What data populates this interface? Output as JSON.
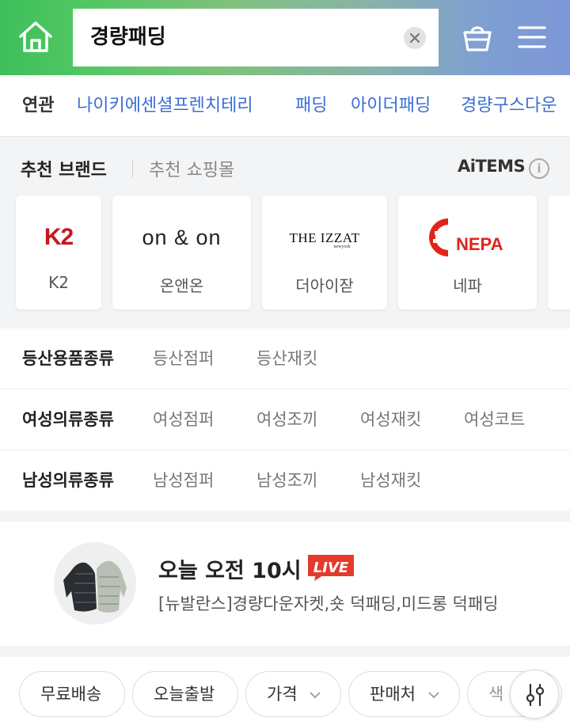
{
  "header": {
    "search_value": "경량패딩",
    "icons": [
      "home-icon",
      "close-icon",
      "cart-icon",
      "menu-icon"
    ]
  },
  "related": {
    "title": "연관",
    "links": [
      "나이키에센셜프렌치테리",
      "패딩",
      "아이더패딩",
      "경량구스다운"
    ]
  },
  "brands": {
    "tab_active": "추천 브랜드",
    "tab_inactive": "추천 쇼핑몰",
    "provider": "AiTEMS",
    "info_label": "i",
    "cards": [
      {
        "name": "K2",
        "logo_text": "K2"
      },
      {
        "name": "온앤온",
        "logo_text": "on & on"
      },
      {
        "name": "더아이잗",
        "logo_text": "THE IZZAT",
        "logo_sub": "newyork"
      },
      {
        "name": "네파",
        "logo_text": "NEPA"
      }
    ]
  },
  "categories": [
    {
      "title": "등산용품종류",
      "items": [
        "등산점퍼",
        "등산재킷"
      ]
    },
    {
      "title": "여성의류종류",
      "items": [
        "여성점퍼",
        "여성조끼",
        "여성재킷",
        "여성코트"
      ]
    },
    {
      "title": "남성의류종류",
      "items": [
        "남성점퍼",
        "남성조끼",
        "남성재킷"
      ]
    }
  ],
  "live": {
    "title": "오늘 오전 10시",
    "badge": "LIVE",
    "description": "[뉴발란스]경량다운자켓,숏 덕패딩,미드롱 덕패딩"
  },
  "filters": {
    "chips": [
      "무료배송",
      "오늘출발",
      "가격",
      "판매처",
      "색"
    ]
  },
  "colors": {
    "link_blue": "#3c6dd6",
    "live_red": "#e33a2c",
    "k2_red": "#c8161e",
    "nepa_red": "#e2231a"
  }
}
